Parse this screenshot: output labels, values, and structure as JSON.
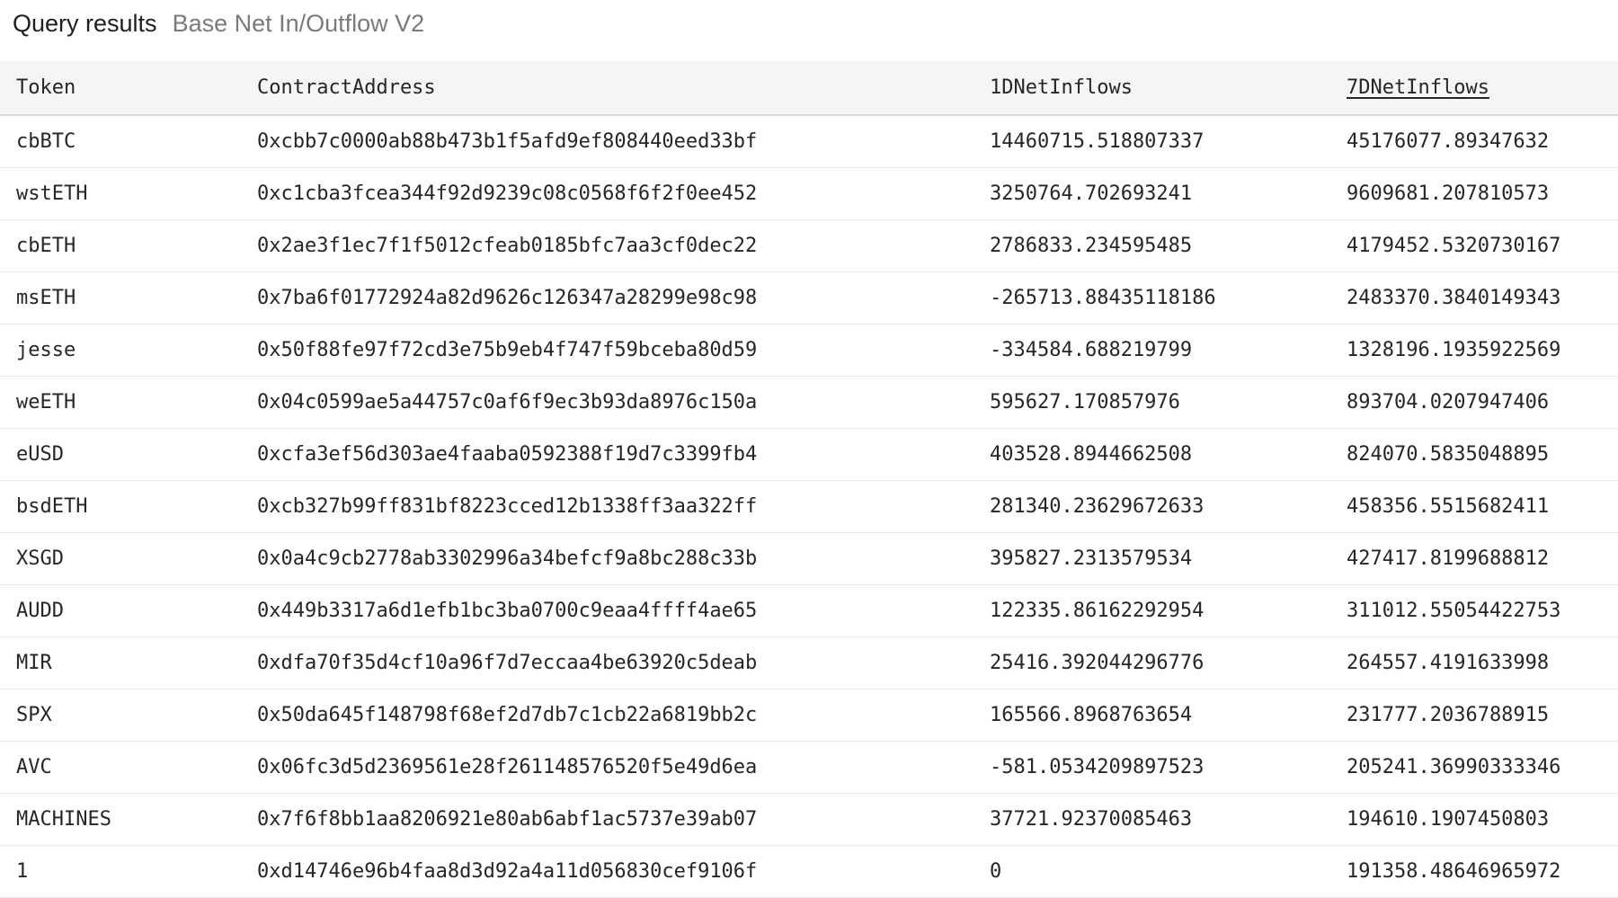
{
  "header": {
    "title": "Query results",
    "subtitle": "Base Net In/Outflow V2"
  },
  "table": {
    "columns": [
      "Token",
      "ContractAddress",
      "1DNetInflows",
      "7DNetInflows"
    ],
    "sorted_column": "7DNetInflows",
    "rows": [
      [
        "cbBTC",
        "0xcbb7c0000ab88b473b1f5afd9ef808440eed33bf",
        "14460715.518807337",
        "45176077.89347632"
      ],
      [
        "wstETH",
        "0xc1cba3fcea344f92d9239c08c0568f6f2f0ee452",
        "3250764.702693241",
        "9609681.207810573"
      ],
      [
        "cbETH",
        "0x2ae3f1ec7f1f5012cfeab0185bfc7aa3cf0dec22",
        "2786833.234595485",
        "4179452.5320730167"
      ],
      [
        "msETH",
        "0x7ba6f01772924a82d9626c126347a28299e98c98",
        "-265713.88435118186",
        "2483370.3840149343"
      ],
      [
        "jesse",
        "0x50f88fe97f72cd3e75b9eb4f747f59bceba80d59",
        "-334584.688219799",
        "1328196.1935922569"
      ],
      [
        "weETH",
        "0x04c0599ae5a44757c0af6f9ec3b93da8976c150a",
        "595627.170857976",
        "893704.0207947406"
      ],
      [
        "eUSD",
        "0xcfa3ef56d303ae4faaba0592388f19d7c3399fb4",
        "403528.8944662508",
        "824070.5835048895"
      ],
      [
        "bsdETH",
        "0xcb327b99ff831bf8223cced12b1338ff3aa322ff",
        "281340.23629672633",
        "458356.5515682411"
      ],
      [
        "XSGD",
        "0x0a4c9cb2778ab3302996a34befcf9a8bc288c33b",
        "395827.2313579534",
        "427417.8199688812"
      ],
      [
        "AUDD",
        "0x449b3317a6d1efb1bc3ba0700c9eaa4ffff4ae65",
        "122335.86162292954",
        "311012.55054422753"
      ],
      [
        "MIR",
        "0xdfa70f35d4cf10a96f7d7eccaa4be63920c5deab",
        "25416.392044296776",
        "264557.4191633998"
      ],
      [
        "SPX",
        "0x50da645f148798f68ef2d7db7c1cb22a6819bb2c",
        "165566.8968763654",
        "231777.2036788915"
      ],
      [
        "AVC",
        "0x06fc3d5d2369561e28f261148576520f5e49d6ea",
        "-581.0534209897523",
        "205241.36990333346"
      ],
      [
        "MACHINES",
        "0x7f6f8bb1aa8206921e80ab6abf1ac5737e39ab07",
        "37721.92370085463",
        "194610.1907450803"
      ],
      [
        "1",
        "0xd14746e96b4faa8d3d92a4a11d056830cef9106f",
        "0",
        "191358.48646965972"
      ]
    ]
  }
}
